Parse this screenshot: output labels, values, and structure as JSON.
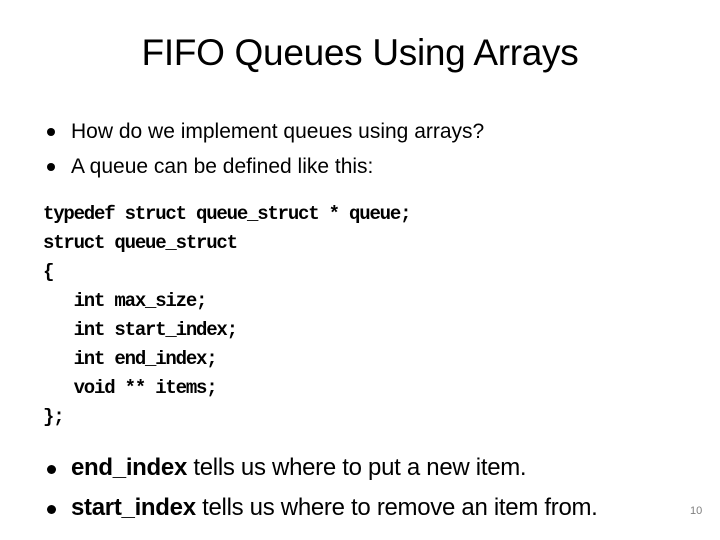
{
  "slide": {
    "title": "FIFO Queues Using Arrays",
    "bullets_top": [
      {
        "text": "How do we implement queues using arrays?"
      },
      {
        "text": "A queue can be defined like this:"
      }
    ],
    "code_lines": [
      "typedef struct queue_struct * queue;",
      "struct queue_struct",
      "{",
      "   int max_size;",
      "   int start_index;",
      "   int end_index;",
      "   void ** items;",
      "};"
    ],
    "bullets_bottom": [
      {
        "bold": "end_index",
        "text": " tells us where to put a new item."
      },
      {
        "bold": "start_index",
        "text": " tells us where to remove an item from."
      }
    ],
    "page_number": "10"
  },
  "icons": {
    "bullet": "bullet-dot-icon"
  }
}
